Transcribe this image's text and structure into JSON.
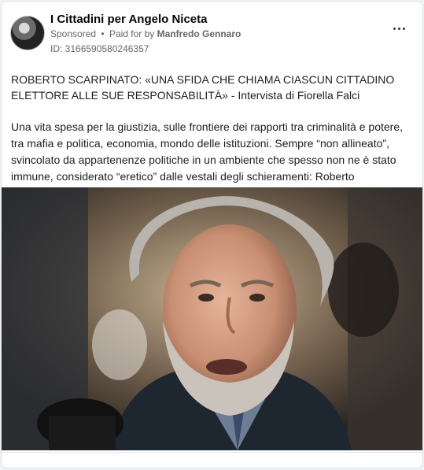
{
  "post": {
    "page_name": "I Cittadini per Angelo Niceta",
    "sponsored_label": "Sponsored",
    "separator": "•",
    "paid_for_prefix": "Paid for by",
    "payer": "Manfredo Gennaro",
    "ad_id": "ID: 3166590580246357",
    "headline": "ROBERTO SCARPINATO: «UNA SFIDA CHE CHIAMA CIASCUN CITTADINO ELETTORE ALLE SUE RESPONSABILITÀ» - Intervista di Fiorella Falci",
    "body": "Una vita spesa per la giustizia, sulle frontiere dei rapporti tra criminalità e potere, tra mafia e politica, economia, mondo delle istituzioni. Sempre “non allineato”, svincolato da appartenenze politiche in un ambiente che spesso non ne è stato immune, considerato “eretico” dalle vestali degli schieramenti: Roberto Scarpinat…"
  }
}
